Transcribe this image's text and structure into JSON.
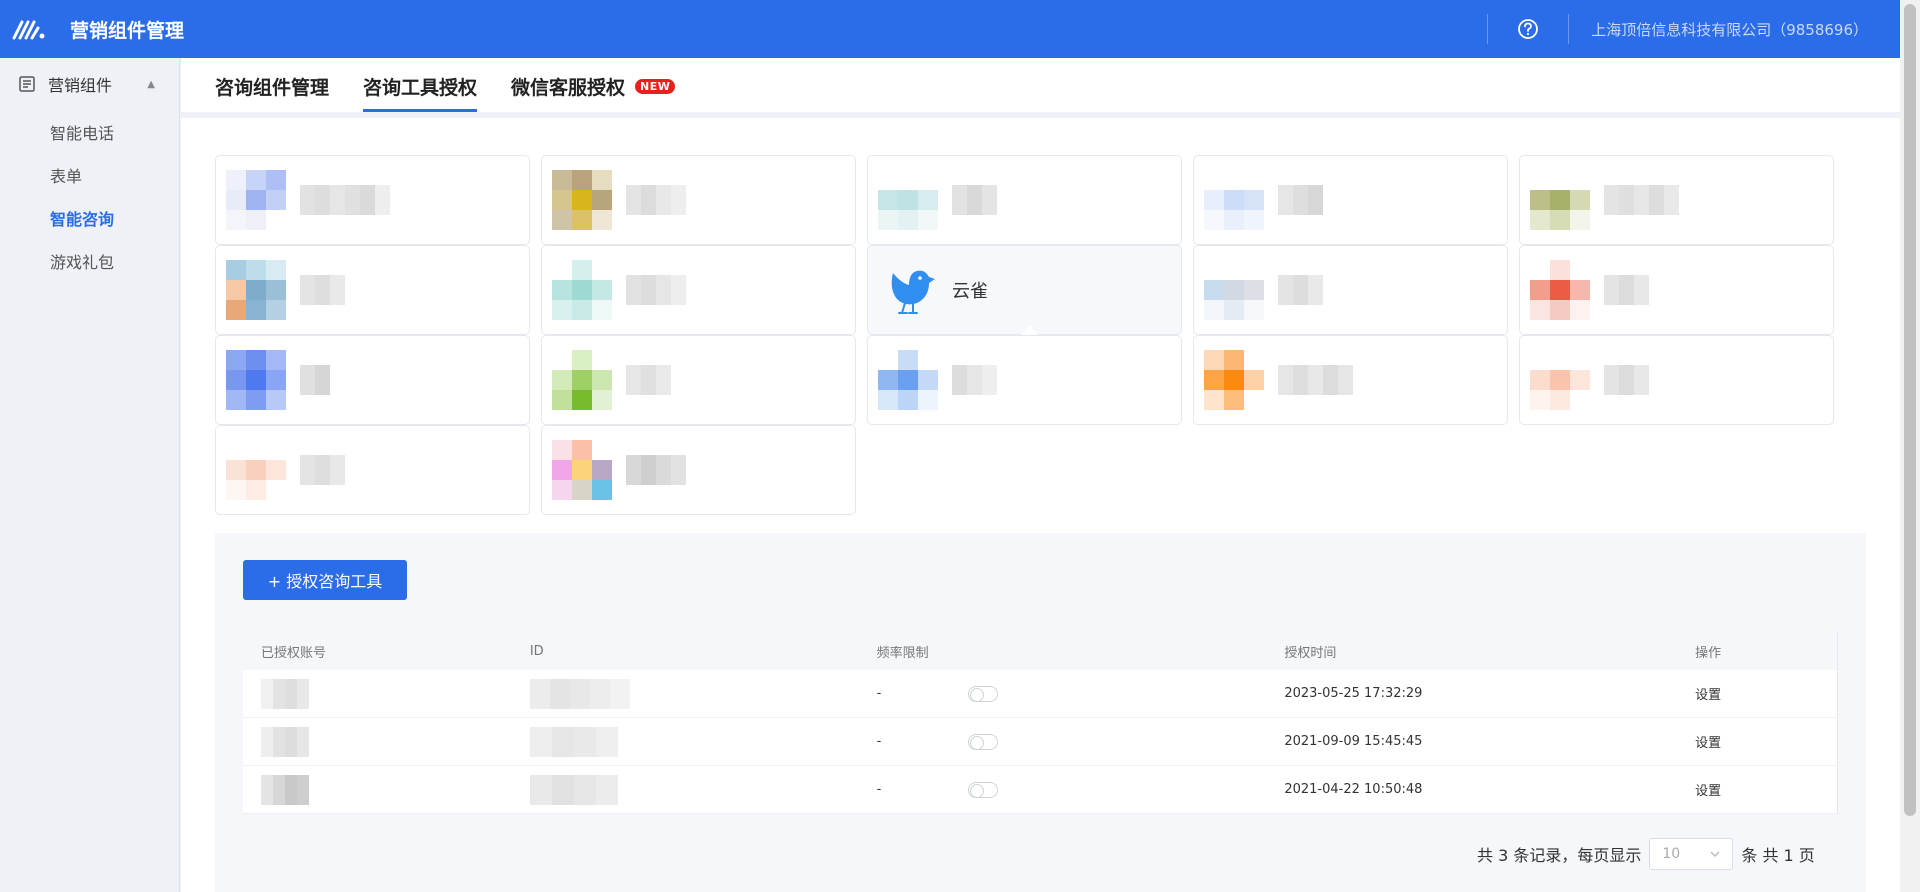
{
  "header": {
    "title": "营销组件管理",
    "company": "上海顶倍信息科技有限公司（9858696）"
  },
  "sidebar": {
    "group_label": "营销组件",
    "items": [
      {
        "label": "智能电话"
      },
      {
        "label": "表单"
      },
      {
        "label": "智能咨询"
      },
      {
        "label": "游戏礼包"
      }
    ]
  },
  "tabs": [
    {
      "label": "咨询组件管理"
    },
    {
      "label": "咨询工具授权"
    },
    {
      "label": "微信客服授权"
    }
  ],
  "tab_badge": "NEW",
  "selected_tool": "云雀",
  "add_button": "+ 授权咨询工具",
  "table": {
    "headers": [
      "已授权账号",
      "ID",
      "频率限制",
      "授权时间",
      "操作"
    ],
    "rows": [
      {
        "freq": "-",
        "time": "2023-05-25 17:32:29",
        "op": "设置"
      },
      {
        "freq": "-",
        "time": "2021-09-09 15:45:45",
        "op": "设置"
      },
      {
        "freq": "-",
        "time": "2021-04-22 10:50:48",
        "op": "设置"
      }
    ]
  },
  "pagination": {
    "total_text": "共 3 条记录，每页显示",
    "page_size": "10",
    "unit_text": "条 共 1 页"
  },
  "colors": {
    "primary": "#2b6ce8",
    "badge": "#e8211f",
    "sidebar_bg": "#eef1f6"
  }
}
